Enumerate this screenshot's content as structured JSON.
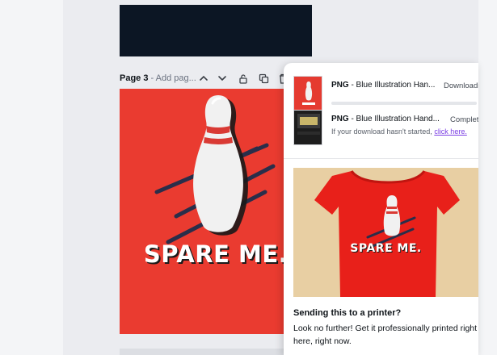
{
  "canvas": {
    "page_label": "Page 3",
    "page_title_placeholder": "Add pag...",
    "design_text": "SPARE ME."
  },
  "downloads": [
    {
      "format": "PNG",
      "name": " - Blue Illustration Han...",
      "status": "Downloading",
      "progress": 0.0
    },
    {
      "format": "PNG",
      "name": " - Blue Illustration Hand...",
      "status": "Complete",
      "hint": "If your download hasn't started,",
      "link": "click here."
    }
  ],
  "promo": {
    "shirt_text": "SPARE ME.",
    "title": "Sending this to a printer?",
    "body": "Look no further! Get it professionally printed right here, right now."
  },
  "colors": {
    "artboard": "#ea3b30",
    "shirt": "#e8201a",
    "link": "#7b3fe4"
  },
  "icons": [
    "chevron-up-icon",
    "chevron-down-icon",
    "lock-icon",
    "duplicate-icon",
    "delete-icon"
  ]
}
